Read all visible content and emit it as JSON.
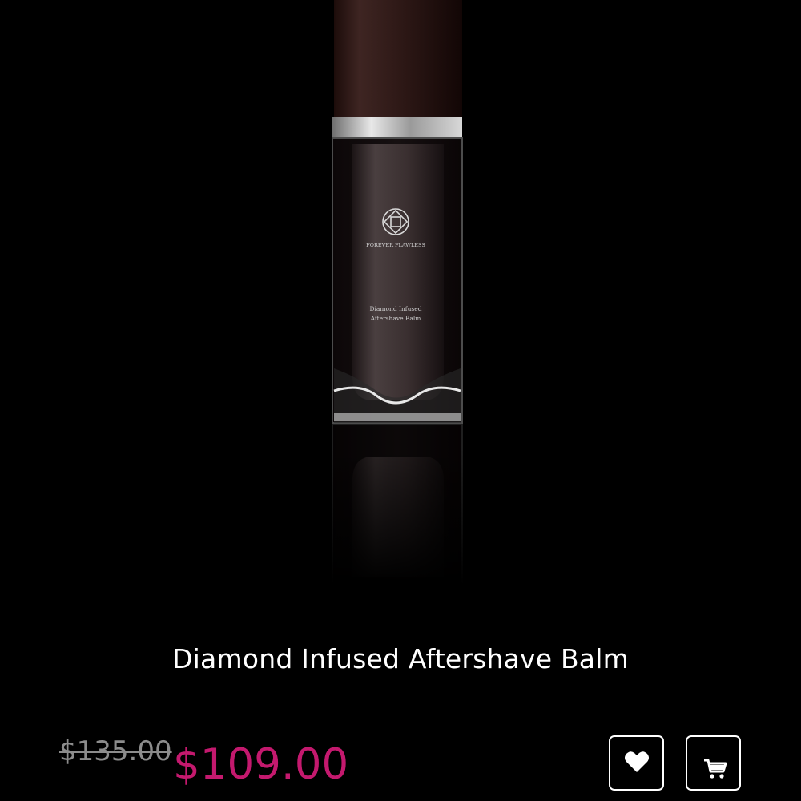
{
  "product": {
    "name": "Diamond Infused Aftershave Balm",
    "original_price": "$135.00",
    "sale_price": "$109.00",
    "bottle_brand_text": "FOREVER FLAWLESS",
    "bottle_label_line1": "Diamond Infused",
    "bottle_label_line2": "Aftershave Balm"
  },
  "actions": {
    "wishlist_icon": "heart-icon",
    "cart_icon": "shopping-cart-icon"
  },
  "colors": {
    "background": "#000000",
    "title": "#ffffff",
    "original_price": "#8c8c8c",
    "sale_price": "#c4196e",
    "button_border": "#ffffff"
  }
}
